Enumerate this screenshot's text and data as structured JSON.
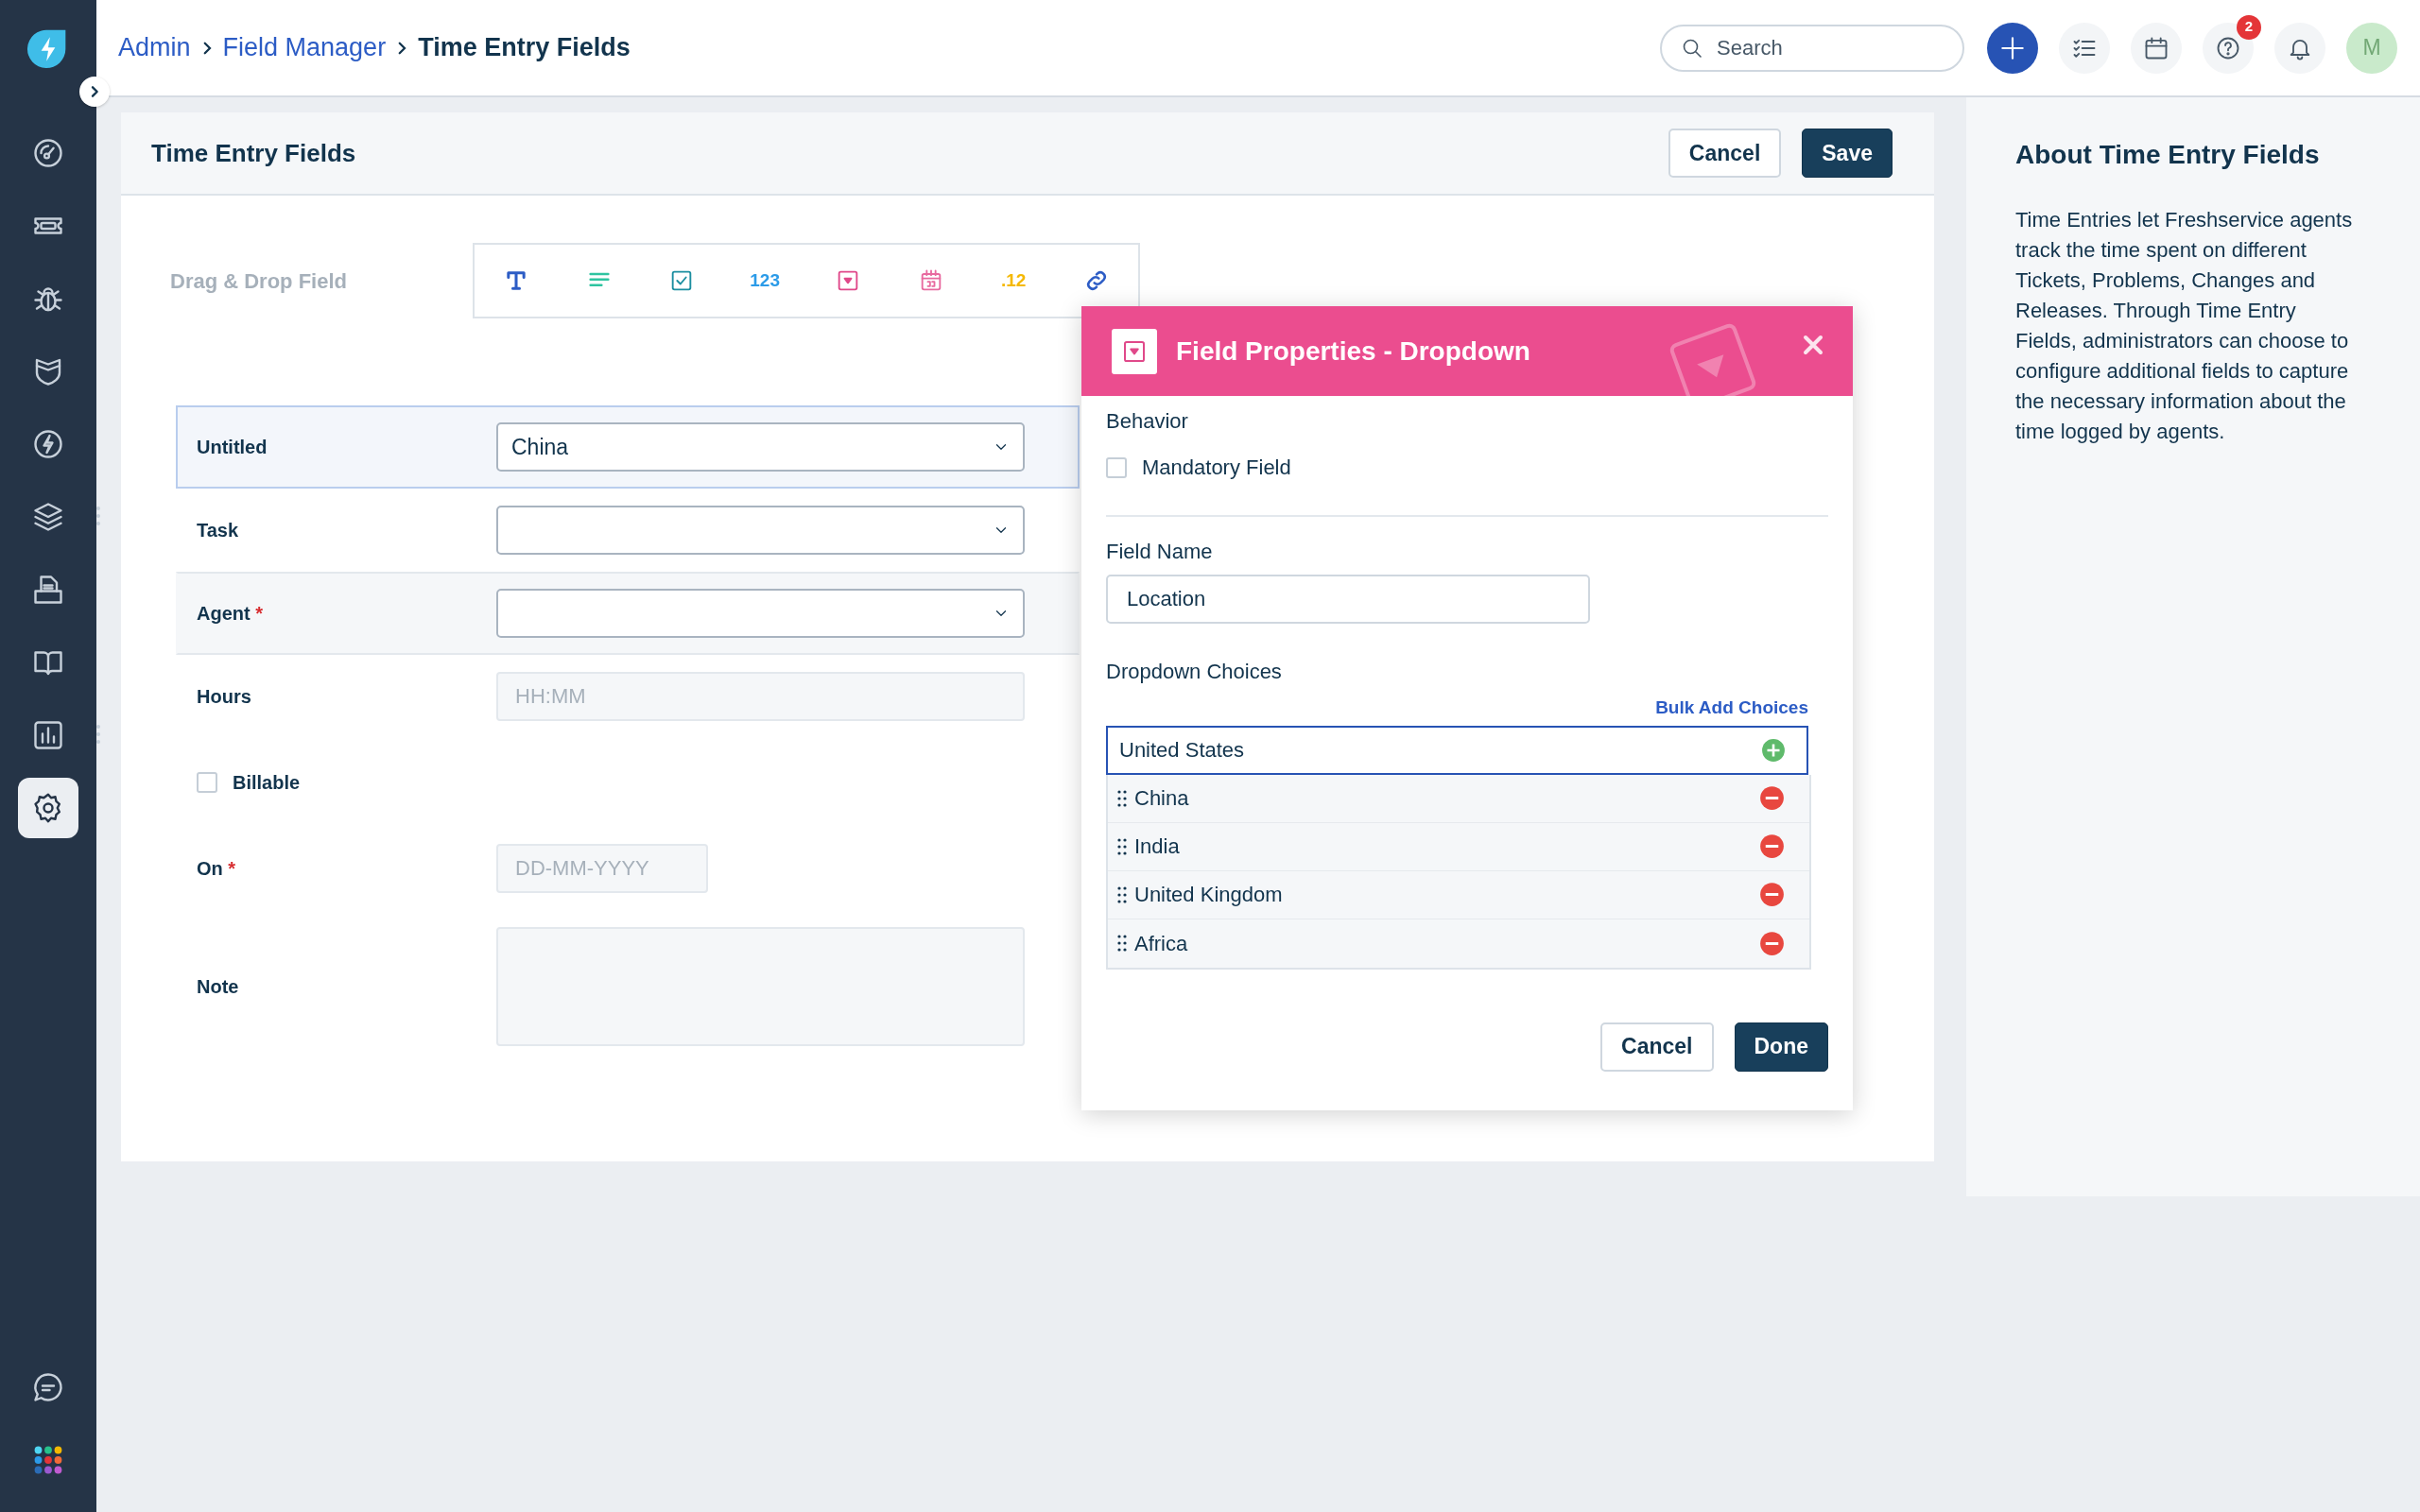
{
  "sidebar": {
    "items": [
      {
        "kind": "gauge",
        "selected": false,
        "has_menu": false
      },
      {
        "kind": "ticket",
        "selected": false,
        "has_menu": false
      },
      {
        "kind": "bug",
        "selected": false,
        "has_menu": false
      },
      {
        "kind": "shield",
        "selected": false,
        "has_menu": false
      },
      {
        "kind": "bolt",
        "selected": false,
        "has_menu": false
      },
      {
        "kind": "layers",
        "selected": false,
        "has_menu": true
      },
      {
        "kind": "document",
        "selected": false,
        "has_menu": false
      },
      {
        "kind": "book",
        "selected": false,
        "has_menu": false
      },
      {
        "kind": "chart",
        "selected": false,
        "has_menu": true
      },
      {
        "kind": "settings",
        "selected": true,
        "has_menu": false
      }
    ],
    "bottom_items": [
      {
        "kind": "chat"
      },
      {
        "kind": "apps"
      }
    ]
  },
  "breadcrumb": [
    {
      "label": "Admin",
      "kind": "link"
    },
    {
      "label": "Field Manager",
      "kind": "link"
    },
    {
      "label": "Time Entry Fields",
      "kind": "current"
    }
  ],
  "search": {
    "placeholder": "Search"
  },
  "header_icons": [
    {
      "kind": "add"
    },
    {
      "kind": "tasks"
    },
    {
      "kind": "calendar"
    },
    {
      "kind": "help",
      "badge": "2"
    },
    {
      "kind": "bell"
    }
  ],
  "avatar": {
    "initial": "M"
  },
  "page": {
    "title": "Time Entry Fields",
    "buttons": [
      {
        "label": "Cancel",
        "kind": "secondary"
      },
      {
        "label": "Save",
        "kind": "primary"
      }
    ]
  },
  "palette": {
    "label": "Drag & Drop Field",
    "field_types": [
      {
        "kind": "text"
      },
      {
        "kind": "paragraph"
      },
      {
        "kind": "checkbox"
      },
      {
        "kind": "number",
        "glyph": "123"
      },
      {
        "kind": "dropdown"
      },
      {
        "kind": "date"
      },
      {
        "kind": "decimal",
        "glyph": ".12"
      },
      {
        "kind": "url"
      }
    ]
  },
  "form_fields": [
    {
      "label": "Untitled",
      "kind": "select",
      "value": "China",
      "selected": true,
      "hovered": false
    },
    {
      "label": "Task",
      "kind": "select",
      "selected": false,
      "hovered": false
    },
    {
      "label": "Agent",
      "kind": "select",
      "required_mark": "*",
      "selected": false,
      "hovered": true
    },
    {
      "label": "Hours",
      "kind": "text",
      "placeholder": "HH:MM",
      "selected": false,
      "hovered": false
    },
    {
      "label": "Billable",
      "kind": "checkbox",
      "checked": false,
      "selected": false,
      "hovered": false
    },
    {
      "label": "On",
      "kind": "date",
      "placeholder": "DD-MM-YYYY",
      "required_mark": "*",
      "selected": false,
      "hovered": false
    },
    {
      "label": "Note",
      "kind": "textarea",
      "selected": false,
      "hovered": false
    }
  ],
  "modal": {
    "title": "Field Properties - Dropdown",
    "behavior_label": "Behavior",
    "mandatory": {
      "label": "Mandatory Field",
      "checked": false
    },
    "field_name_label": "Field Name",
    "field_name": "Location",
    "choices_label": "Dropdown Choices",
    "bulk_add": "Bulk Add Choices",
    "new_choice": "United States",
    "choices": [
      "China",
      "India",
      "United Kingdom",
      "Africa"
    ],
    "buttons": [
      {
        "label": "Cancel",
        "kind": "secondary"
      },
      {
        "label": "Done",
        "kind": "primary"
      }
    ]
  },
  "about": {
    "title": "About Time Entry Fields",
    "text": "Time Entries let Freshservice agents track the time spent on different Tickets, Problems, Changes and Releases. Through Time Entry Fields, administrators can choose to configure additional fields to capture the necessary information about the time logged by agents."
  }
}
